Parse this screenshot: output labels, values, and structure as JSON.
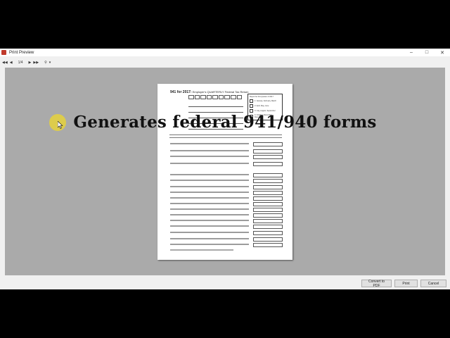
{
  "window": {
    "title": "Print Preview"
  },
  "toolbar": {
    "page_indicator": "1/4"
  },
  "form": {
    "title_prefix": "941 for 2017:",
    "title_rest": "Employer's QUARTERLY Federal Tax Return",
    "quarter_header": "Report for this Quarter of 2017",
    "quarters": [
      "1: January, February, March",
      "2: April, May, June",
      "3: July, August, September",
      "4: October, November, December"
    ]
  },
  "overlay": {
    "caption": "Generates federal 941/940 forms"
  },
  "buttons": {
    "convert_pdf": "Convert to PDF",
    "print": "Print",
    "cancel": "Cancel"
  },
  "colors": {
    "viewport_bg": "#aaaaaa",
    "highlight": "#e6d23c"
  }
}
